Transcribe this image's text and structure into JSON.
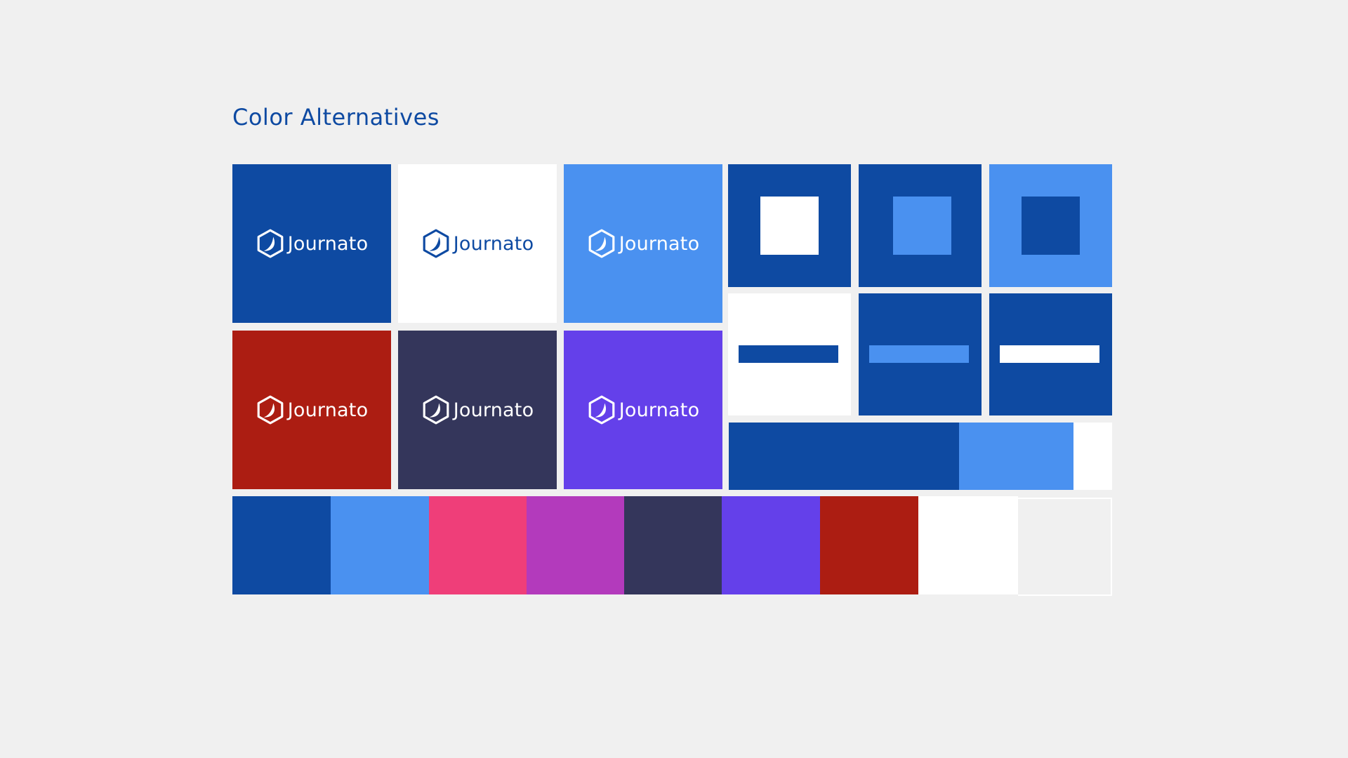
{
  "page": {
    "title": "Color Alternatives"
  },
  "colors": {
    "navy": "#0e4aa2",
    "sky": "#4a91f0",
    "pink": "#ef3e79",
    "magenta": "#b33abc",
    "slate": "#34365b",
    "violet": "#6440ea",
    "crimson": "#ac1d12",
    "white": "#ffffff",
    "light_gray": "#f0f0f0"
  },
  "logo_tiles": [
    {
      "wordmark": "Journato",
      "background": "#0e4aa2",
      "logo_color": "#ffffff"
    },
    {
      "wordmark": "Journato",
      "background": "#ffffff",
      "logo_color": "#0e4aa2"
    },
    {
      "wordmark": "Journato",
      "background": "#4a91f0",
      "logo_color": "#ffffff"
    },
    {
      "wordmark": "Journato",
      "background": "#ac1d12",
      "logo_color": "#ffffff"
    },
    {
      "wordmark": "Journato",
      "background": "#34365b",
      "logo_color": "#ffffff"
    },
    {
      "wordmark": "Journato",
      "background": "#6440ea",
      "logo_color": "#ffffff"
    }
  ],
  "square_tiles": [
    {
      "outer": "#0e4aa2",
      "inner": "#ffffff"
    },
    {
      "outer": "#0e4aa2",
      "inner": "#4a91f0"
    },
    {
      "outer": "#4a91f0",
      "inner": "#0e4aa2"
    }
  ],
  "bar_tiles": [
    {
      "outer": "#ffffff",
      "bar": "#0e4aa2"
    },
    {
      "outer": "#0e4aa2",
      "bar": "#4a91f0"
    },
    {
      "outer": "#0e4aa2",
      "bar": "#ffffff"
    }
  ],
  "proportion_bar": [
    {
      "color": "#0e4aa2",
      "share": 0.6
    },
    {
      "color": "#4a91f0",
      "share": 0.3
    },
    {
      "color": "#ffffff",
      "share": 0.1
    }
  ],
  "palette": [
    {
      "name": "navy",
      "color": "#0e4aa2"
    },
    {
      "name": "sky",
      "color": "#4a91f0"
    },
    {
      "name": "pink",
      "color": "#ef3e79"
    },
    {
      "name": "magenta",
      "color": "#b33abc"
    },
    {
      "name": "slate",
      "color": "#34365b"
    },
    {
      "name": "violet",
      "color": "#6440ea"
    },
    {
      "name": "crimson",
      "color": "#ac1d12"
    },
    {
      "name": "white",
      "color": "#ffffff"
    },
    {
      "name": "light-gray",
      "color": "#f0f0f0"
    }
  ]
}
